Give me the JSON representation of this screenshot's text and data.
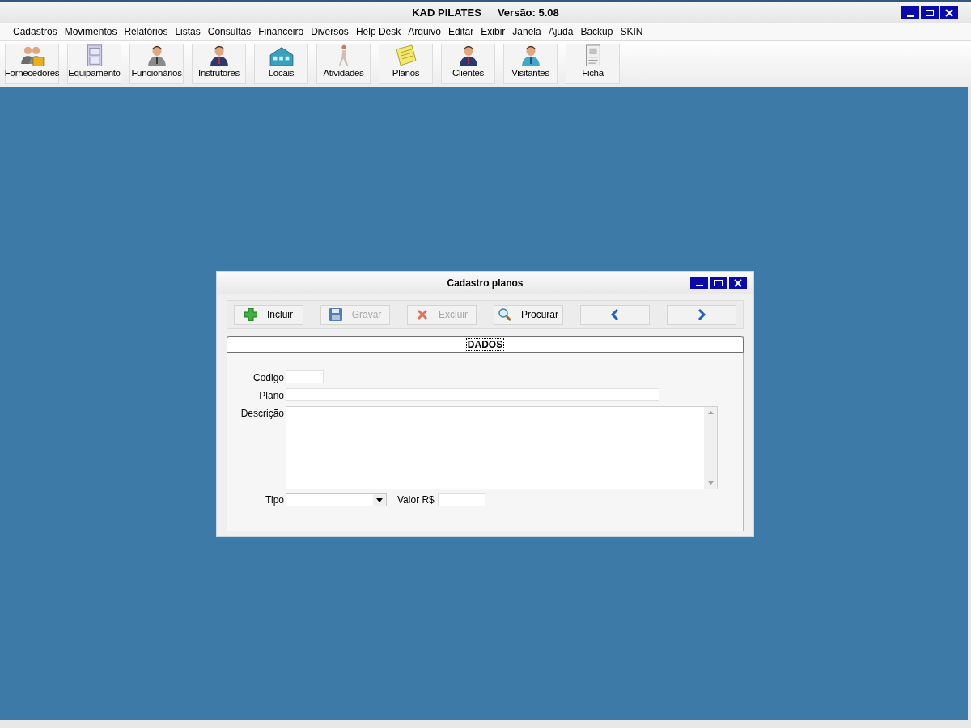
{
  "window": {
    "title": "KAD PILATES",
    "version": "Versão: 5.08"
  },
  "menu": [
    "Cadastros",
    "Movimentos",
    "Relatórios",
    "Listas",
    "Consultas",
    "Financeiro",
    "Diversos",
    "Help Desk",
    "Arquivo",
    "Editar",
    "Exibir",
    "Janela",
    "Ajuda",
    "Backup",
    "SKIN"
  ],
  "toolbar": [
    {
      "label": "Fornecedores",
      "kind": "group"
    },
    {
      "label": "Equipamento",
      "kind": "cabinet"
    },
    {
      "label": "Funcionários",
      "kind": "person-gray"
    },
    {
      "label": "Instrutores",
      "kind": "person-navy"
    },
    {
      "label": "Locais",
      "kind": "building"
    },
    {
      "label": "Atividades",
      "kind": "runner"
    },
    {
      "label": "Planos",
      "kind": "note"
    },
    {
      "label": "Clientes",
      "kind": "person-navy"
    },
    {
      "label": "Visitantes",
      "kind": "person-teal"
    },
    {
      "label": "Ficha",
      "kind": "card"
    }
  ],
  "dialog": {
    "title": "Cadastro planos",
    "actions": [
      {
        "label": "Incluir",
        "kind": "add",
        "disabled": false
      },
      {
        "label": "Gravar",
        "kind": "save",
        "disabled": true
      },
      {
        "label": "Excluir",
        "kind": "delete",
        "disabled": true
      },
      {
        "label": "Procurar",
        "kind": "search",
        "disabled": false
      },
      {
        "kind": "prev",
        "disabled": false
      },
      {
        "kind": "next",
        "disabled": false
      }
    ],
    "tab": "DADOS",
    "fields": {
      "codigo": "Codigo",
      "plano": "Plano",
      "descricao": "Descrição",
      "tipo": "Tipo",
      "valor": "Valor R$"
    }
  }
}
